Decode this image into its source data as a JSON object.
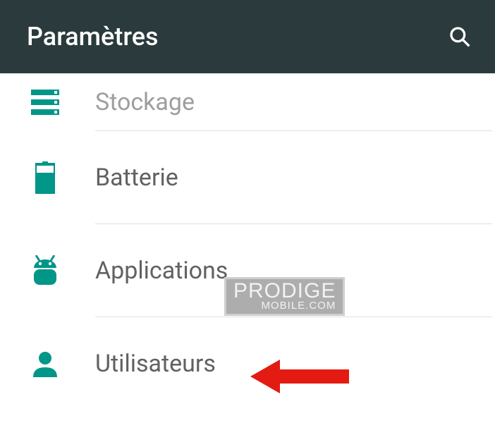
{
  "header": {
    "title": "Paramètres"
  },
  "items": [
    {
      "label": "Stockage",
      "icon": "storage-icon"
    },
    {
      "label": "Batterie",
      "icon": "battery-icon"
    },
    {
      "label": "Applications",
      "icon": "apps-icon"
    },
    {
      "label": "Utilisateurs",
      "icon": "user-icon"
    }
  ],
  "watermark": {
    "line1": "PRODIGE",
    "line2": "MOBILE.COM"
  },
  "colors": {
    "teal": "#009688",
    "header_bg": "#2b3a3d",
    "annotation_red": "#e31b12"
  }
}
